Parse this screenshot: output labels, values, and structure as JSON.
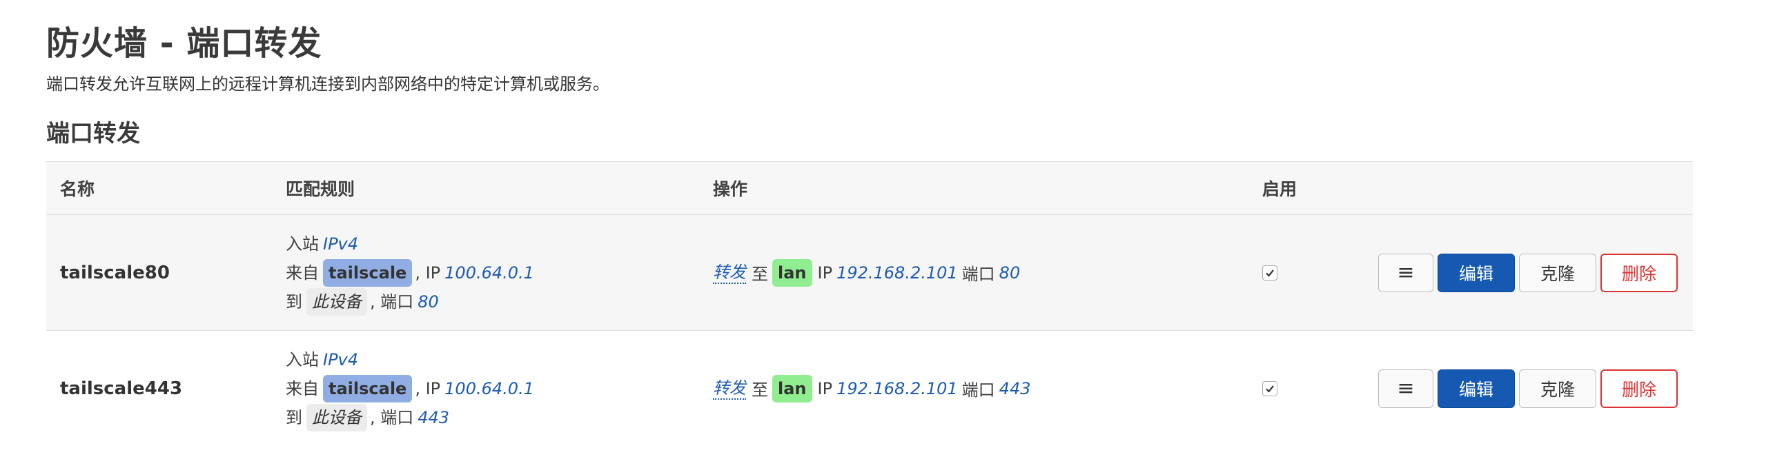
{
  "page": {
    "title": "防火墙 - 端口转发",
    "description": "端口转发允许互联网上的远程计算机连接到内部网络中的特定计算机或服务。",
    "section_title": "端口转发"
  },
  "table": {
    "headers": {
      "name": "名称",
      "match": "匹配规则",
      "action": "操作",
      "enable": "启用"
    },
    "rows": [
      {
        "name": "tailscale80",
        "inbound_label": "入站",
        "family": "IPv4",
        "from_label": "来自",
        "src_zone": "tailscale",
        "src_ip_label": ", IP",
        "src_ip": "100.64.0.1",
        "to_label": "到",
        "dest_device": "此设备",
        "dest_port_label": ", 端口",
        "dest_port": "80",
        "action_verb": "转发",
        "action_to": "至",
        "target_zone": "lan",
        "target_ip_label": "IP",
        "target_ip": "192.168.2.101",
        "target_port_label": "端口",
        "target_port": "80",
        "enabled": true
      },
      {
        "name": "tailscale443",
        "inbound_label": "入站",
        "family": "IPv4",
        "from_label": "来自",
        "src_zone": "tailscale",
        "src_ip_label": ", IP",
        "src_ip": "100.64.0.1",
        "to_label": "到",
        "dest_device": "此设备",
        "dest_port_label": ", 端口",
        "dest_port": "443",
        "action_verb": "转发",
        "action_to": "至",
        "target_zone": "lan",
        "target_ip_label": "IP",
        "target_ip": "192.168.2.101",
        "target_port_label": "端口",
        "target_port": "443",
        "enabled": true
      }
    ]
  },
  "buttons": {
    "menu": "≡",
    "edit": "编辑",
    "clone": "克隆",
    "delete": "删除"
  },
  "icons": {
    "checkbox": "check-icon",
    "menu": "hamburger-icon"
  },
  "colors": {
    "zone_tailscale": "#90aee3",
    "zone_lan": "#90ee90",
    "link": "#1c5cb5",
    "edit_button": "#1659b3",
    "delete_button": "#dd3333"
  }
}
